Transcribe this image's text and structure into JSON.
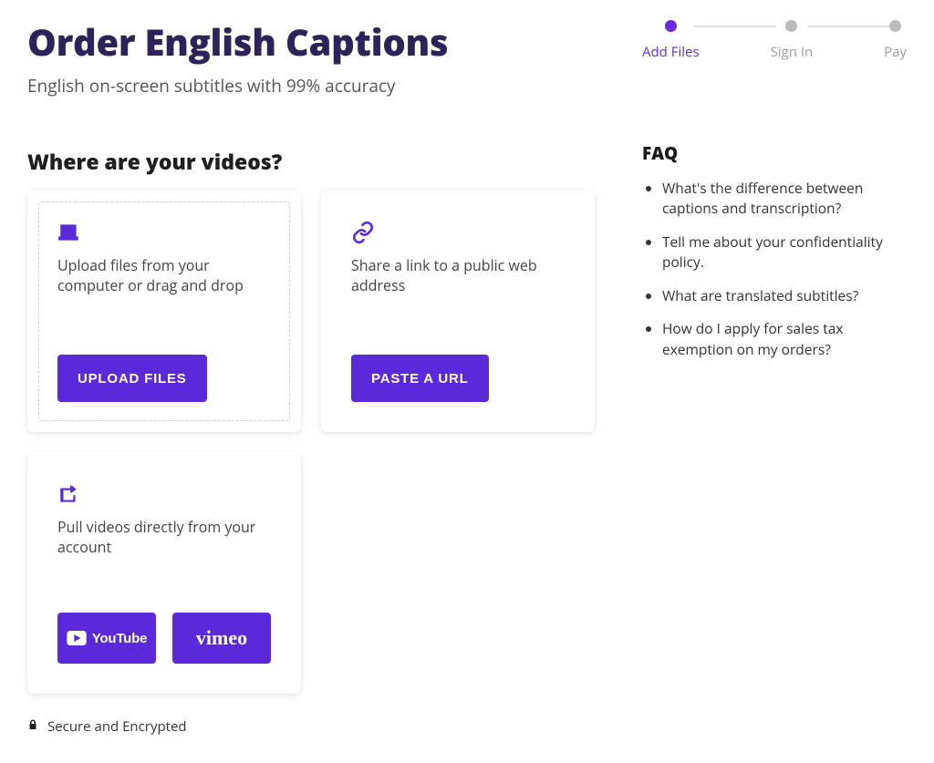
{
  "header": {
    "title": "Order English Captions",
    "tagline": "English on-screen subtitles with 99% accuracy"
  },
  "section": {
    "title": "Where are your videos?"
  },
  "cards": {
    "upload": {
      "desc": "Upload files from your computer or drag and drop",
      "button": "Upload Files"
    },
    "url": {
      "desc": "Share a link to a public web address",
      "button": "Paste a URL"
    },
    "pull": {
      "desc": "Pull videos directly from your account",
      "youtube_label": "YouTube",
      "vimeo_label": "vimeo"
    }
  },
  "footer": {
    "secure": "Secure and Encrypted"
  },
  "stepper": {
    "steps": [
      {
        "label": "Add Files",
        "active": true
      },
      {
        "label": "Sign In",
        "active": false
      },
      {
        "label": "Pay",
        "active": false
      }
    ]
  },
  "faq": {
    "title": "FAQ",
    "items": [
      "What's the difference between captions and transcription?",
      "Tell me about your confidentiality policy.",
      "What are translated subtitles?",
      "How do I apply for sales tax exemption on my orders?"
    ]
  }
}
